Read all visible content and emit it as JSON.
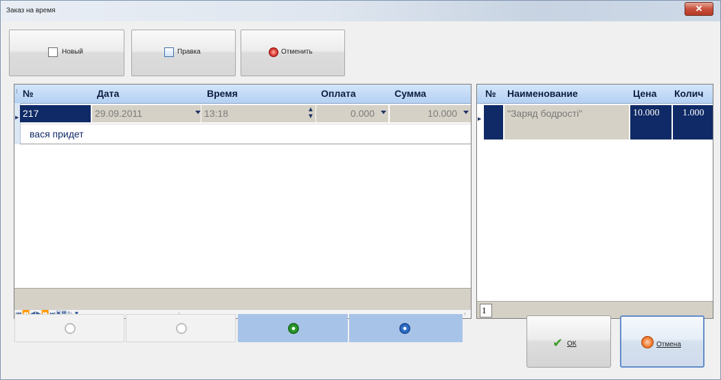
{
  "window": {
    "title": "Заказ на время",
    "close_label": "✕"
  },
  "toolbar": {
    "new_label": "Новый",
    "edit_label": "Правка",
    "cancel_label": "Отменить"
  },
  "orders": {
    "columns": [
      "№",
      "Дата",
      "Время",
      "Оплата",
      "Сумма"
    ],
    "row": {
      "number": "217",
      "date": "29.09.2011",
      "time": "13:18",
      "payment": "0.000",
      "sum": "10.000",
      "note": "вася придет"
    }
  },
  "items": {
    "columns": [
      "№",
      "Наименование",
      "Цена",
      "Колич"
    ],
    "row": {
      "name": "\"Заряд бодрості\"",
      "price": "10.000",
      "qty": "1.000"
    },
    "count": "1"
  },
  "buttons": {
    "ok_label": "ОК",
    "cancel_label": "Отмена"
  },
  "colors": {
    "selection": "#0f2a66",
    "header": "#b4d0f2",
    "readonly_cell": "#d6d1c6",
    "active_nav": "#a8c3e8"
  }
}
